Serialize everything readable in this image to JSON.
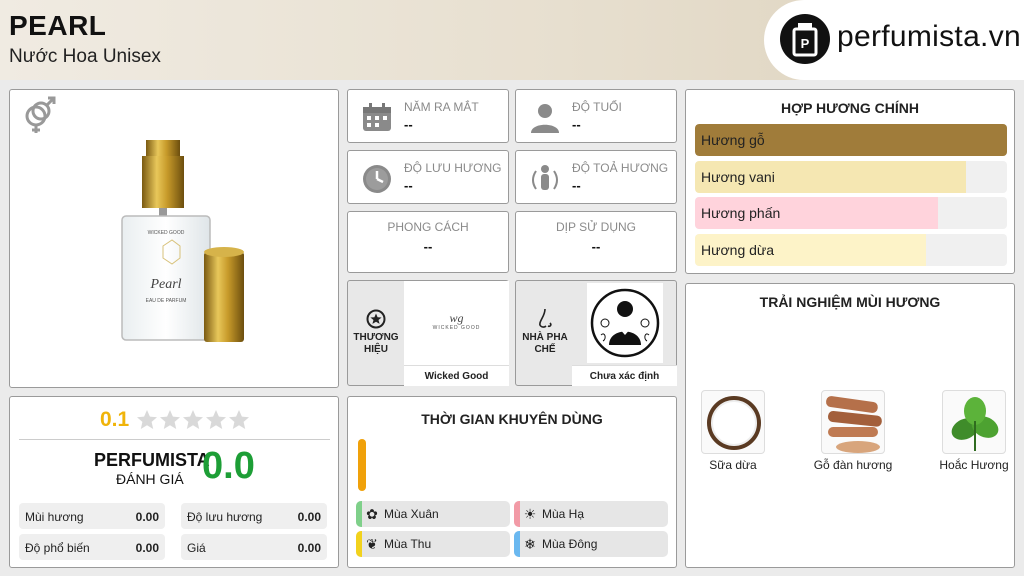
{
  "header": {
    "title": "PEARL",
    "subtitle": "Nước Hoa Unisex",
    "logo_text": "perfumista.vn"
  },
  "product": {
    "bottle_brand_text": "WICKED GOOD",
    "bottle_name_text": "Pearl",
    "bottle_type_text": "EAU DE PARFUM",
    "gender_icon": "unisex-gender-icon"
  },
  "info": {
    "release_year": {
      "label": "NĂM RA MẮT",
      "value": "--",
      "icon": "calendar-icon"
    },
    "age": {
      "label": "ĐỘ TUỔI",
      "value": "--",
      "icon": "person-icon"
    },
    "longevity": {
      "label": "ĐỘ LƯU HƯƠNG",
      "value": "--",
      "icon": "clock-icon"
    },
    "sillage": {
      "label": "ĐỘ TOẢ HƯƠNG",
      "value": "--",
      "icon": "sillage-icon"
    },
    "style": {
      "label": "PHONG CÁCH",
      "value": "--"
    },
    "occasion": {
      "label": "DỊP SỬ DỤNG",
      "value": "--"
    }
  },
  "brand": {
    "label": "THƯƠNG HIỆU",
    "name": "Wicked Good",
    "logo_text": "WICKED GOOD"
  },
  "perfumer": {
    "label": "NHÀ PHA CHẾ",
    "name": "Chưa xác định"
  },
  "accords": {
    "heading": "HỢP HƯƠNG CHÍNH",
    "items": [
      {
        "label": "Hương gỗ",
        "value": 1.0,
        "color": "#a07c3a"
      },
      {
        "label": "Hương vani",
        "value": 0.87,
        "color": "#f5e7b2"
      },
      {
        "label": "Hương phấn",
        "value": 0.78,
        "color": "#ffd3dc"
      },
      {
        "label": "Hương dừa",
        "value": 0.74,
        "color": "#fdf3c8"
      }
    ]
  },
  "experience": {
    "heading": "TRẢI NGHIỆM MÙI HƯƠNG",
    "items": [
      {
        "label": "Sữa dừa",
        "icon": "coconut-icon"
      },
      {
        "label": "Gỗ đàn hương",
        "icon": "sandalwood-icon"
      },
      {
        "label": "Hoắc Hương",
        "icon": "patchouli-icon"
      }
    ]
  },
  "rating": {
    "score": "0.1",
    "stars_filled": 0,
    "stars_total": 5,
    "perfumista_label": "PERFUMISTA",
    "rating_label": "ĐÁNH GIÁ",
    "perfumista_score": "0.0",
    "metrics": [
      {
        "label": "Mùi hương",
        "value": "0.00"
      },
      {
        "label": "Độ lưu hương",
        "value": "0.00"
      },
      {
        "label": "Độ phổ biến",
        "value": "0.00"
      },
      {
        "label": "Giá",
        "value": "0.00"
      }
    ]
  },
  "usage_time": {
    "heading": "THỜI GIAN KHUYÊN DÙNG",
    "seasons": [
      {
        "label": "Mùa Xuân",
        "color": "#7fd08a",
        "icon": "flower-icon"
      },
      {
        "label": "Mùa Hạ",
        "color": "#f29aa6",
        "icon": "sun-icon"
      },
      {
        "label": "Mùa Thu",
        "color": "#f2d21d",
        "icon": "leaf-icon"
      },
      {
        "label": "Mùa Đông",
        "color": "#6ab8f0",
        "icon": "snowflake-icon"
      }
    ],
    "day_night_color": "#f0a10a"
  }
}
